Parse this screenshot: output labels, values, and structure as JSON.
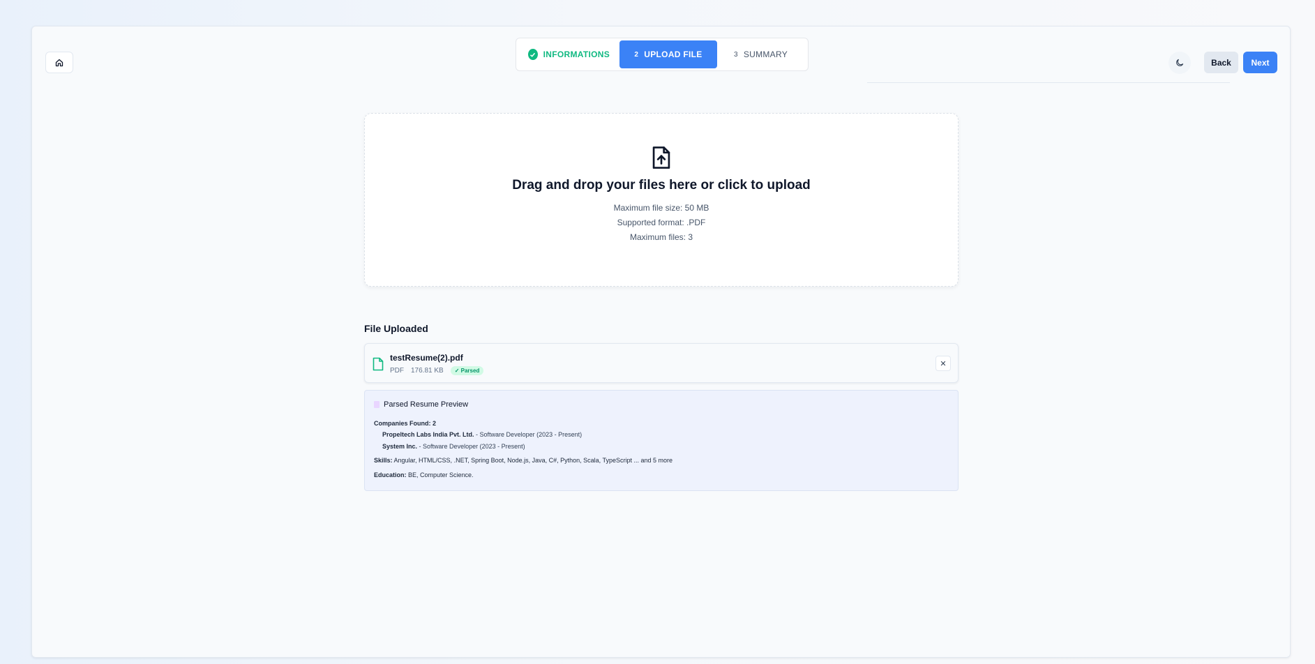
{
  "stepper": {
    "steps": [
      {
        "label": "INFORMATIONS",
        "num": "",
        "state": "done"
      },
      {
        "label": "UPLOAD FILE",
        "num": "2",
        "state": "active"
      },
      {
        "label": "SUMMARY",
        "num": "3",
        "state": "upcoming"
      }
    ]
  },
  "header": {
    "back_label": "Back",
    "next_label": "Next"
  },
  "dropzone": {
    "title": "Drag and drop your files here or click to upload",
    "max_size": "Maximum file size: 50 MB",
    "format": "Supported format: .PDF",
    "max_files": "Maximum files: 3"
  },
  "uploaded": {
    "title": "File Uploaded",
    "file": {
      "name": "testResume(2).pdf",
      "type": "PDF",
      "size": "176.81 KB",
      "status": "✓ Parsed"
    }
  },
  "preview": {
    "title": "Parsed Resume Preview",
    "companies_label": "Companies Found: 2",
    "companies": [
      {
        "name": "Propeltech Labs India Pvt. Ltd.",
        "role": "- Software Developer (2023 - Present)"
      },
      {
        "name": "System Inc.",
        "role": "- Software Developer (2023 - Present)"
      }
    ],
    "skills_label": "Skills:",
    "skills": "Angular, HTML/CSS, .NET, Spring Boot, Node.js, Java, C#, Python, Scala, TypeScript ... and 5 more",
    "education_label": "Education:",
    "education": "BE, Computer Science."
  },
  "colors": {
    "primary": "#3b82f6",
    "success": "#10b981"
  }
}
